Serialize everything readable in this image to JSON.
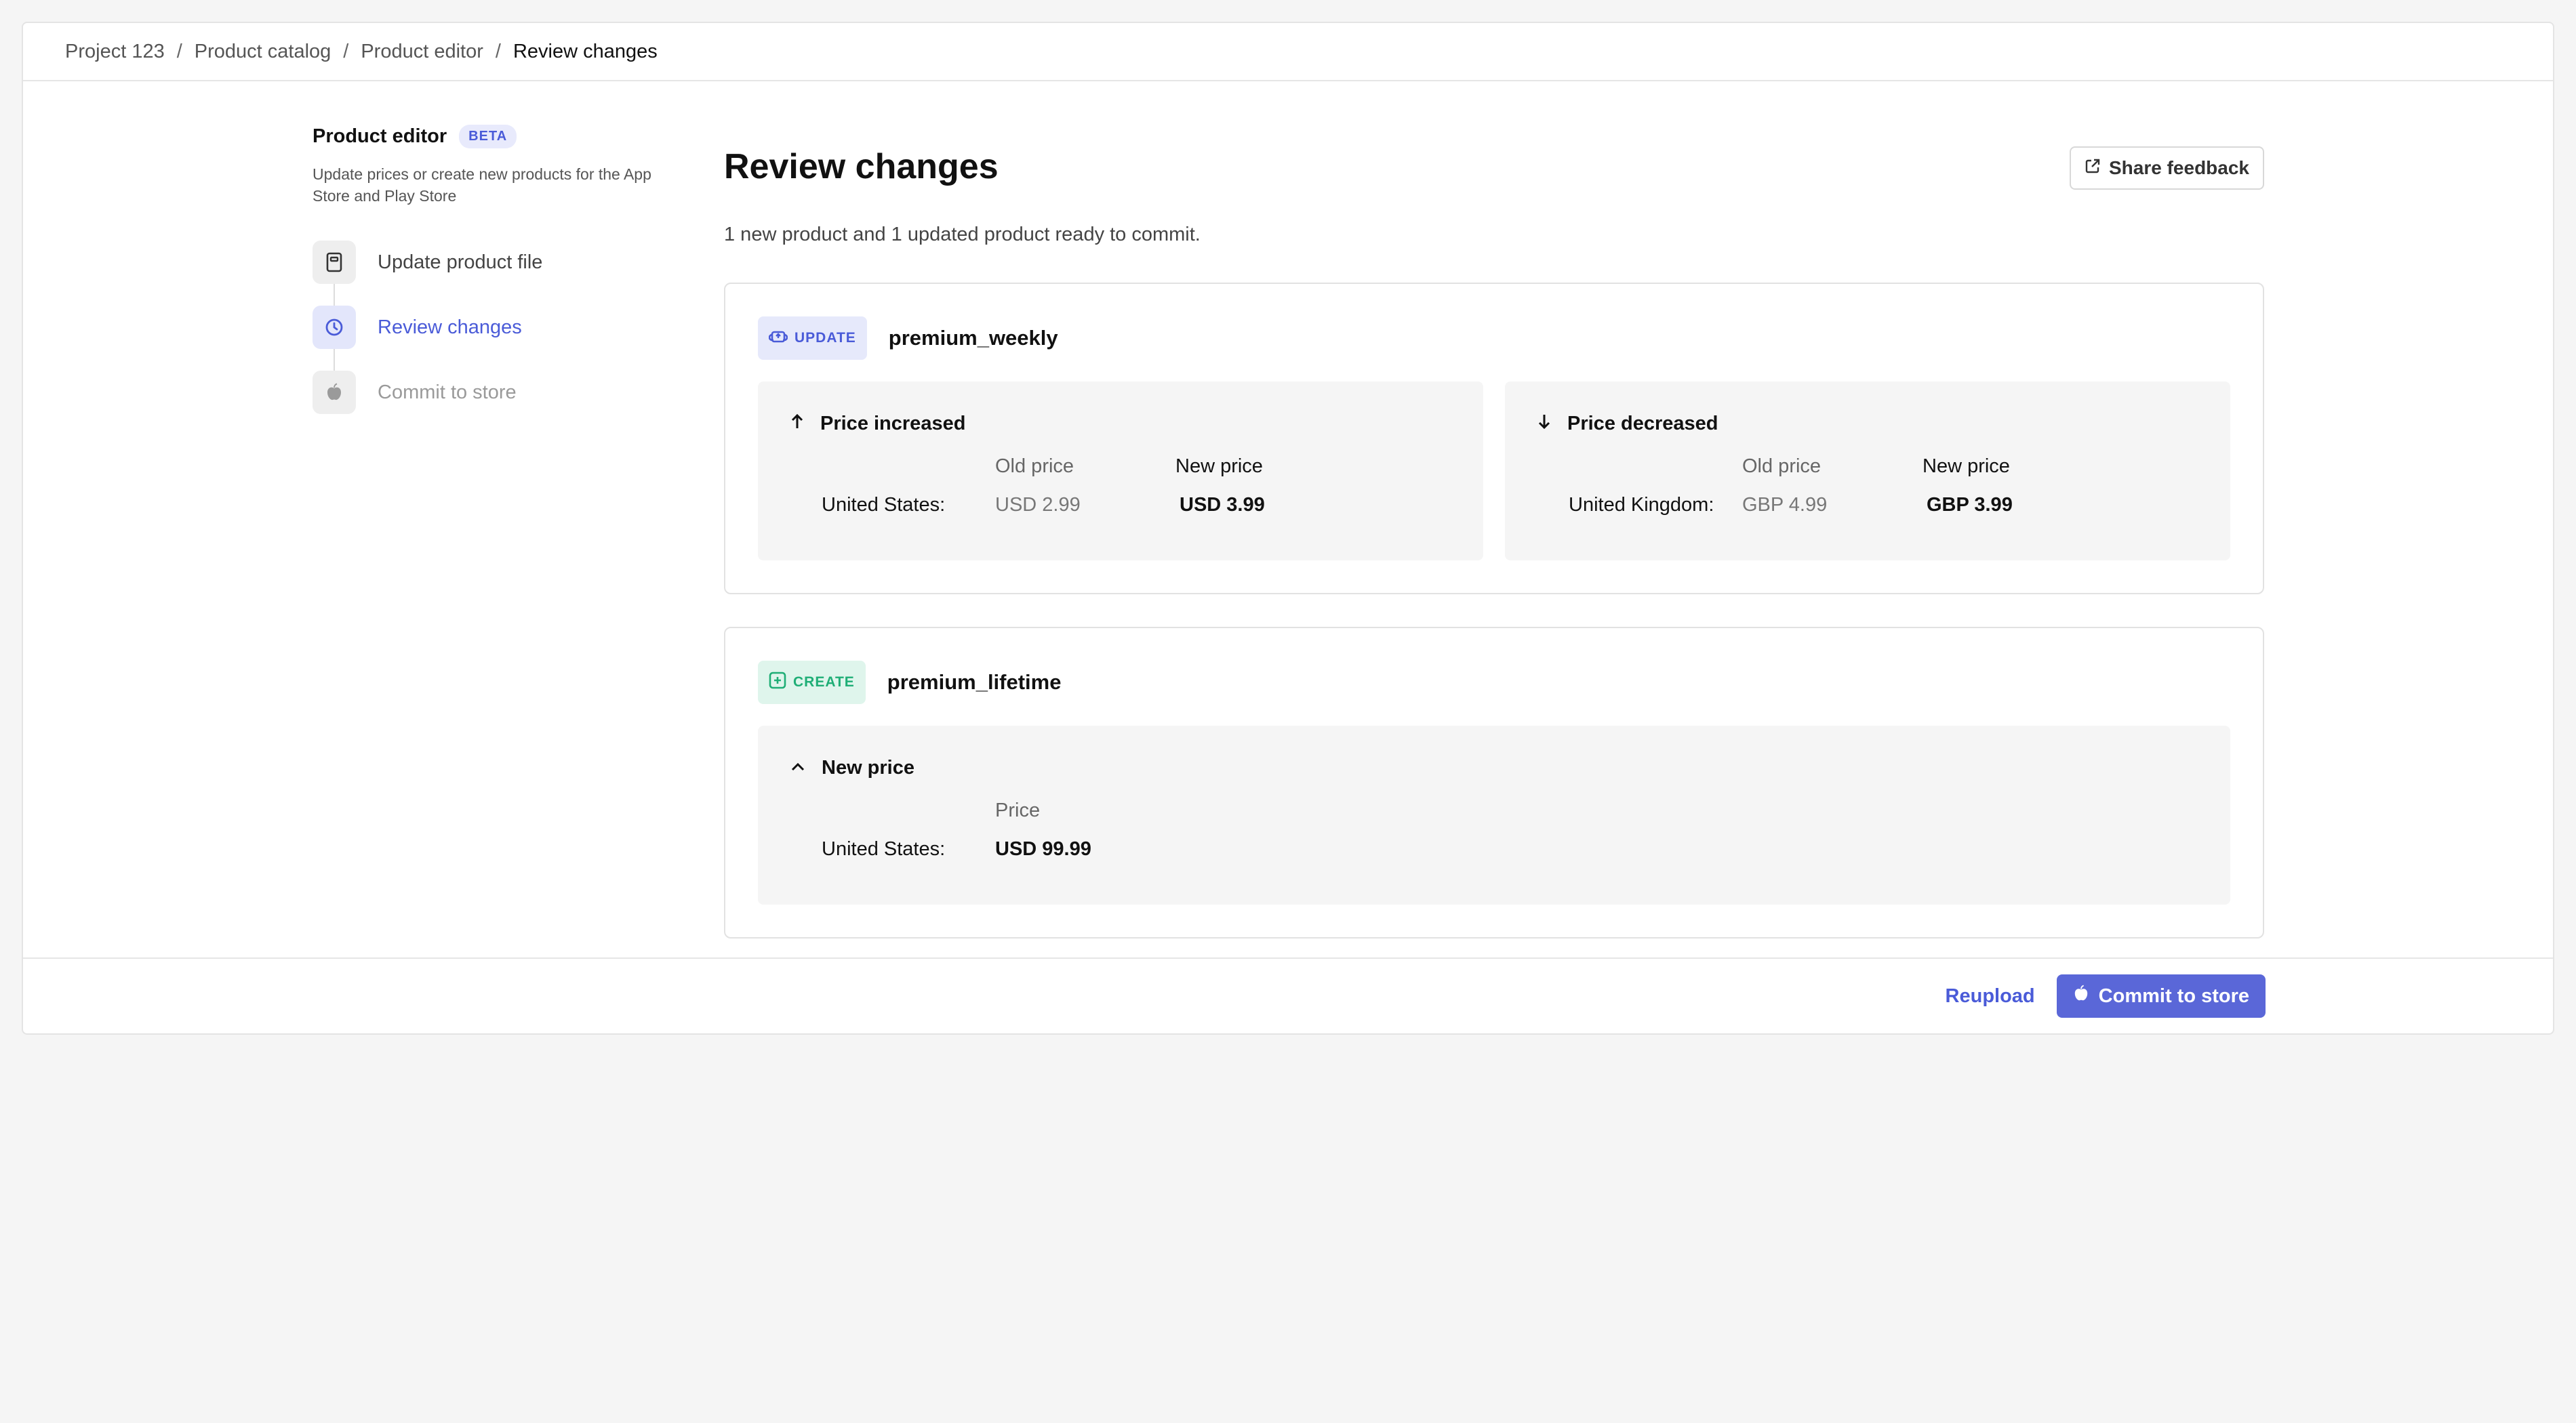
{
  "breadcrumb": {
    "items": [
      "Project 123",
      "Product catalog",
      "Product editor"
    ],
    "separator": "/",
    "current": "Review changes"
  },
  "sidebar": {
    "title": "Product editor",
    "badge": "BETA",
    "description": "Update prices or create new products for the App Store and Play Store",
    "steps": [
      {
        "label": "Update product file",
        "icon": "file-icon",
        "state": "done"
      },
      {
        "label": "Review changes",
        "icon": "clock-icon",
        "state": "active"
      },
      {
        "label": "Commit to store",
        "icon": "apple-icon",
        "state": "disabled"
      }
    ]
  },
  "main": {
    "title": "Review changes",
    "share_label": "Share feedback",
    "summary": "1 new product and 1 updated product ready to commit.",
    "cards": [
      {
        "badge": "UPDATE",
        "badge_icon": "cloud-upload-icon",
        "name": "premium_weekly",
        "boxes": [
          {
            "heading": "Price increased",
            "icon": "arrow-up-icon",
            "old_header": "Old price",
            "new_header": "New price",
            "country": "United States:",
            "old": "USD 2.99",
            "new": "USD 3.99"
          },
          {
            "heading": "Price decreased",
            "icon": "arrow-down-icon",
            "old_header": "Old price",
            "new_header": "New price",
            "country": "United Kingdom:",
            "old": "GBP 4.99",
            "new": "GBP 3.99"
          }
        ]
      },
      {
        "badge": "CREATE",
        "badge_icon": "plus-square-icon",
        "name": "premium_lifetime",
        "box": {
          "heading": "New price",
          "icon": "chevron-up-icon",
          "price_header": "Price",
          "country": "United States:",
          "price": "USD 99.99"
        }
      }
    ]
  },
  "footer": {
    "reupload_label": "Reupload",
    "commit_label": "Commit to store"
  },
  "colors": {
    "accent": "#5a67d8",
    "create_green": "#1fae76",
    "background": "#f5f5f5"
  }
}
